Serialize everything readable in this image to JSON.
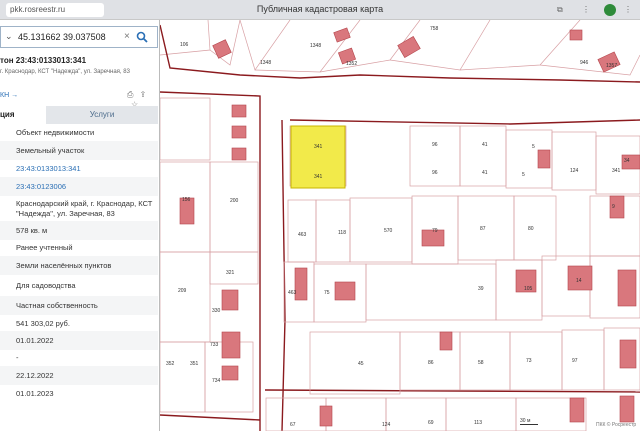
{
  "browser": {
    "url": "pkk.rosreestr.ru",
    "window_title": "Публичная кадастровая карта"
  },
  "search": {
    "value": "45.131662 39.037508"
  },
  "object": {
    "title": "тон 23:43:0133013:341",
    "address": "г. Краснодар, КСТ \"Надежда\", ул. Заречная, 83",
    "link": "КН →"
  },
  "tabs": {
    "info": "ция",
    "services": "Услуги"
  },
  "properties": [
    "Объект недвижимости",
    "Земельный участок",
    "23:43:0133013:341",
    "23:43:0123006",
    "Краснодарский край, г. Краснодар, КСТ \"Надежда\", ул. Заречная, 83",
    "578 кв. м",
    "Ранее учтенный",
    "Земли населённых пунктов",
    "Для садоводства",
    "Частная собственность",
    "541 303,02 руб.",
    "01.01.2022",
    "-",
    "22.12.2022",
    "01.01.2023"
  ],
  "map": {
    "labels": [
      "106",
      "1348",
      "1348",
      "758",
      "1352",
      "946",
      "1357",
      "341",
      "341",
      "96",
      "96",
      "41",
      "41",
      "5",
      "5",
      "124",
      "34",
      "341",
      "156",
      "200",
      "463",
      "118",
      "570",
      "79",
      "87",
      "80",
      "9",
      "321",
      "209",
      "330",
      "463",
      "75",
      "39",
      "105",
      "14",
      "733",
      "734",
      "352",
      "351",
      "45",
      "86",
      "58",
      "73",
      "97",
      "67",
      "124",
      "69",
      "113"
    ],
    "scale": "30 м",
    "copyright": "ПКК © Росреестр"
  }
}
